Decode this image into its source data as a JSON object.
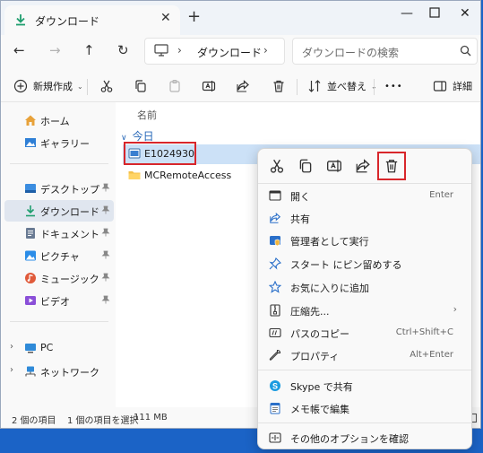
{
  "window": {
    "tab_title": "ダウンロード",
    "close_tab": "✕",
    "new_tab": "+"
  },
  "nav": {
    "breadcrumb": "ダウンロード",
    "search_placeholder": "ダウンロードの検索"
  },
  "toolbar": {
    "new_label": "新規作成",
    "sort_label": "並べ替え",
    "more_label": "•••",
    "details_label": "詳細"
  },
  "sidebar": {
    "items": [
      {
        "label": "ホーム",
        "icon": "home-icon"
      },
      {
        "label": "ギャラリー",
        "icon": "gallery-icon"
      },
      {
        "label": "デスクトップ",
        "icon": "desktop-icon",
        "pinned": true
      },
      {
        "label": "ダウンロード",
        "icon": "download-icon",
        "pinned": true,
        "selected": true
      },
      {
        "label": "ドキュメント",
        "icon": "document-icon",
        "pinned": true
      },
      {
        "label": "ピクチャ",
        "icon": "pictures-icon",
        "pinned": true
      },
      {
        "label": "ミュージック",
        "icon": "music-icon",
        "pinned": true
      },
      {
        "label": "ビデオ",
        "icon": "video-icon",
        "pinned": true
      },
      {
        "label": "PC",
        "icon": "pc-icon",
        "expandable": true
      },
      {
        "label": "ネットワーク",
        "icon": "network-icon",
        "expandable": true
      }
    ]
  },
  "content": {
    "column_header": "名前",
    "group_label": "今日",
    "files": [
      {
        "name": "E1024930",
        "icon": "file-icon",
        "selected": true
      },
      {
        "name": "MCRemoteAccess",
        "icon": "folder-icon",
        "selected": false
      }
    ]
  },
  "status": {
    "item_count": "2 個の項目",
    "selection": "1 個の項目を選択",
    "size": "111 MB"
  },
  "context_menu": {
    "items": [
      {
        "label": "開く",
        "shortcut": "Enter",
        "icon": "open-icon"
      },
      {
        "label": "共有",
        "shortcut": "",
        "icon": "share-icon"
      },
      {
        "label": "管理者として実行",
        "shortcut": "",
        "icon": "shield-icon"
      },
      {
        "label": "スタート にピン留めする",
        "shortcut": "",
        "icon": "pin-icon"
      },
      {
        "label": "お気に入りに追加",
        "shortcut": "",
        "icon": "star-icon"
      },
      {
        "label": "圧縮先...",
        "shortcut": "",
        "icon": "zip-icon",
        "submenu": "›"
      },
      {
        "label": "パスのコピー",
        "shortcut": "Ctrl+Shift+C",
        "icon": "path-icon"
      },
      {
        "label": "プロパティ",
        "shortcut": "Alt+Enter",
        "icon": "wrench-icon"
      },
      {
        "label": "Skype で共有",
        "shortcut": "",
        "icon": "skype-icon"
      },
      {
        "label": "メモ帳で編集",
        "shortcut": "",
        "icon": "notepad-icon"
      },
      {
        "label": "その他のオプションを確認",
        "shortcut": "",
        "icon": "more-options-icon"
      }
    ]
  },
  "colors": {
    "accent": "#2667b8",
    "highlight_box": "#d8262b",
    "selection": "#cce1f7",
    "desktop": "#1b63c6"
  }
}
